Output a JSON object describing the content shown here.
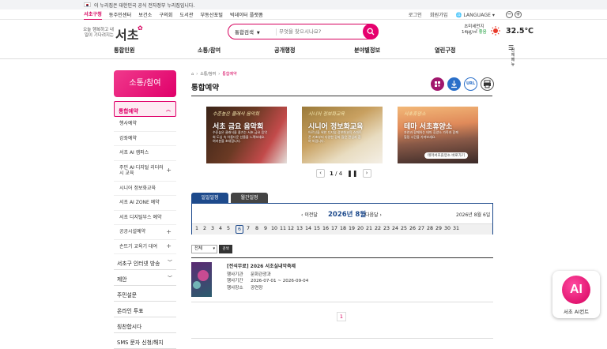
{
  "gov_notice": "이 누리집은 대한민국 공식 전자정부 누리집입니다.",
  "util": {
    "links": [
      "서초구청",
      "동주민센터",
      "보건소",
      "구의회",
      "도서관",
      "부동산포털",
      "빅데이터 플랫폼"
    ],
    "login": "로그인",
    "join": "회원가입",
    "language": "LANGUAGE",
    "zoom_out": "−",
    "zoom_in": "+"
  },
  "logo": {
    "slogan": "오늘 행복하고 내일이 기다려지는",
    "name": "서초"
  },
  "search": {
    "scope": "통합검색",
    "placeholder": "무엇을 찾으시나요?"
  },
  "weather": {
    "label": "초미세먼지",
    "value": "14㎍/㎥",
    "grade": "좋음",
    "temp": "32.5℃"
  },
  "gnb": [
    "통합민원",
    "소통/참여",
    "공개행정",
    "분야별정보",
    "열린구정"
  ],
  "gnb_all": "전체메뉴",
  "side": {
    "title": "소통/참여",
    "current": "통합예약",
    "subs": [
      "행사예약",
      "강좌예약",
      "서초 AI 캠퍼스",
      "주민 AI·디지털 리터러시 교육",
      "시니어 정보화교육",
      "서초 AI ZONE 예약",
      "서초 디지털부스 예약",
      "공공시설예약",
      "손뜨기 교육기 대여"
    ],
    "tops": [
      "서초구 인터넷 방송",
      "제안",
      "주민설문",
      "온라인 투표",
      "칭찬합시다",
      "SMS 문자 신청/해지"
    ]
  },
  "breadcrumb": [
    "소통/참여",
    "통합예약"
  ],
  "page_title": "통합예약",
  "tools": {
    "url": "URL"
  },
  "banners": [
    {
      "title": "서초 금요 음악회",
      "caption": "수준높은 클래식 음악회",
      "desc": "수준높은 클래식을 즐기는 서초 금요 음악회 도심 속 아름다운 선율을 느껴보세요. 여러분을 초대합니다."
    },
    {
      "title": "시니어 정보화교육",
      "caption": "시니어 정보화교육",
      "desc": "어르신을 위한 디지털 정보화교육 스마트폰 기초부터 다양한 강좌 많은 관심과 참여 바랍니다."
    },
    {
      "title": "테마 서초휴양소",
      "caption": "서초휴양소",
      "desc": "자연과 함께하는 테마 휴양소 가족과 함께 힐링 시간을 가져보세요.",
      "more": "테마서초휴양소 바로가기"
    }
  ],
  "slider": {
    "current": "1",
    "total": "4"
  },
  "tabs": [
    "일일일정",
    "월간일정"
  ],
  "calendar": {
    "prev": "이전달",
    "month": "2026년 8월",
    "next": "다음달",
    "today": "2026년 8월 6일",
    "selected_day": 6,
    "days": [
      "1",
      "2",
      "3",
      "4",
      "5",
      "6",
      "7",
      "8",
      "9",
      "10",
      "11",
      "12",
      "13",
      "14",
      "15",
      "16",
      "17",
      "18",
      "19",
      "20",
      "21",
      "22",
      "23",
      "24",
      "25",
      "26",
      "27",
      "28",
      "29",
      "30",
      "31"
    ]
  },
  "filter": {
    "value": "전체",
    "button": "검색"
  },
  "events": [
    {
      "title": "[전석무료] 2026 서초실내악축제",
      "rows": [
        {
          "k": "행사기관",
          "v": "문화관광과"
        },
        {
          "k": "행사기간",
          "v": "2026-07-01 ~ 2026-09-04"
        },
        {
          "k": "행사장소",
          "v": "공연장"
        }
      ]
    }
  ],
  "pagination": [
    "1"
  ],
  "ai_assistant": {
    "badge": "AI",
    "label": "서초 AI컨트"
  },
  "colors": {
    "brand": "#d6005d",
    "navy": "#1d4a8c"
  }
}
